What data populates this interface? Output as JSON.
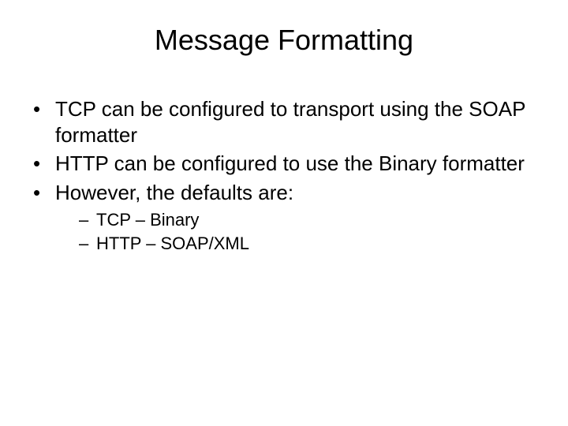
{
  "slide": {
    "title": "Message Formatting",
    "bullets": [
      {
        "text": "TCP can be configured to transport using the SOAP formatter"
      },
      {
        "text": "HTTP can be configured to use the Binary formatter"
      },
      {
        "text": "However, the defaults are:"
      }
    ],
    "subbullets": [
      {
        "text": "TCP – Binary"
      },
      {
        "text": "HTTP – SOAP/XML"
      }
    ]
  }
}
